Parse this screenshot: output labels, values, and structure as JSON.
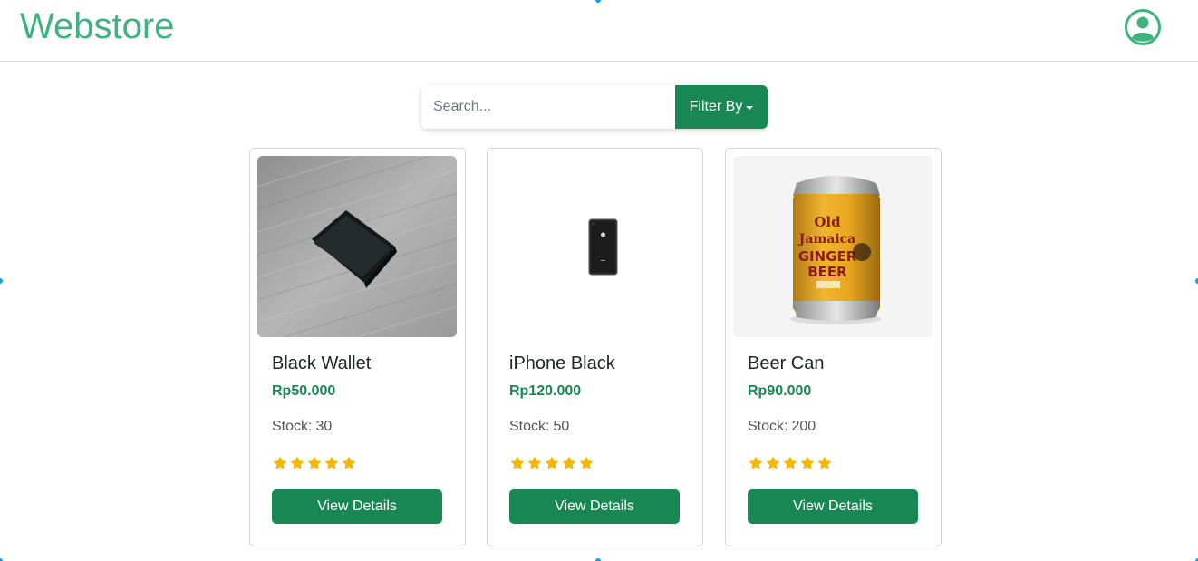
{
  "brand": {
    "name": "Webstore"
  },
  "header": {
    "profile_icon": "user-circle-icon"
  },
  "search": {
    "placeholder": "Search...",
    "value": ""
  },
  "filter": {
    "label": "Filter By"
  },
  "colors": {
    "brand": "#3fb27f",
    "accent": "#198754",
    "star": "#f5b800"
  },
  "products": [
    {
      "name": "Black Wallet",
      "price": "Rp50.000",
      "stock_label": "Stock:",
      "stock": "30",
      "rating": 5,
      "button": "View Details",
      "image": "black-wallet-image"
    },
    {
      "name": "iPhone Black",
      "price": "Rp120.000",
      "stock_label": "Stock:",
      "stock": "50",
      "rating": 5,
      "button": "View Details",
      "image": "iphone-black-image"
    },
    {
      "name": "Beer Can",
      "price": "Rp90.000",
      "stock_label": "Stock:",
      "stock": "200",
      "rating": 5,
      "button": "View Details",
      "image": "beer-can-image"
    }
  ]
}
